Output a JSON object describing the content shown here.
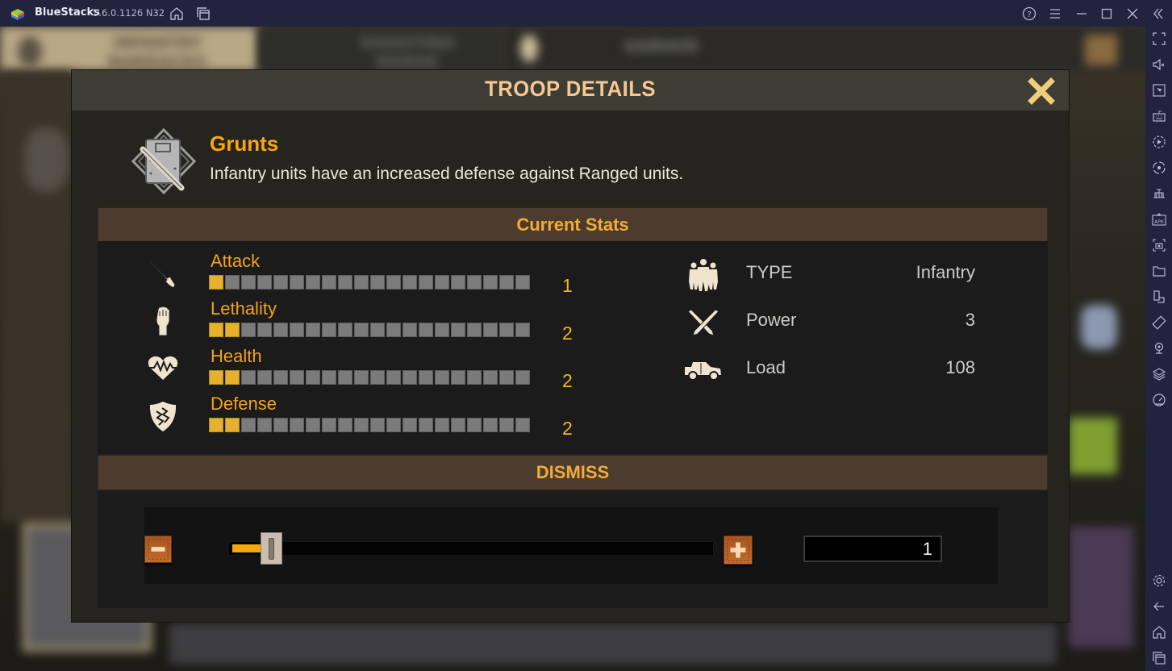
{
  "window": {
    "app_name": "BlueStacks",
    "version": "5.6.0.1126 N32",
    "titlebar_icons": [
      "home-icon",
      "multi-instance-icon",
      "help-icon",
      "menu-icon",
      "minimize-icon",
      "maximize-icon",
      "close-icon",
      "collapse-sidebar-icon"
    ]
  },
  "sidebar": {
    "icons": [
      "fullscreen-icon",
      "volume-mute-icon",
      "pointer-icon",
      "keyboard-icon",
      "macro-recorder-icon",
      "sync-icon",
      "bulk-build-icon",
      "install-apk-icon",
      "screenshot-icon",
      "folder-icon",
      "multi-instance-icon",
      "rotate-icon",
      "location-icon",
      "layers-icon",
      "performance-icon"
    ],
    "bottom_icons": [
      "settings-icon",
      "back-icon",
      "home-icon",
      "recent-apps-icon"
    ]
  },
  "background": {
    "tabs": [
      "INFANTRY BARRACKS",
      "SHOOTING RANGE",
      "GARAGE"
    ]
  },
  "modal": {
    "title": "TROOP DETAILS",
    "unit": {
      "name": "Grunts",
      "description": "Infantry units have an increased defense against Ranged units."
    },
    "current_stats_header": "Current Stats",
    "stats": [
      {
        "label": "Attack",
        "icon": "knife-icon",
        "value": "1",
        "filled": 1,
        "total": 20
      },
      {
        "label": "Lethality",
        "icon": "fist-icon",
        "value": "2",
        "filled": 2,
        "total": 20
      },
      {
        "label": "Health",
        "icon": "heartbeat-icon",
        "value": "2",
        "filled": 2,
        "total": 20
      },
      {
        "label": "Defense",
        "icon": "shield-icon",
        "value": "2",
        "filled": 2,
        "total": 20
      }
    ],
    "info": [
      {
        "label": "TYPE",
        "icon": "soldiers-icon",
        "value": "Infantry"
      },
      {
        "label": "Power",
        "icon": "crossed-knives-icon",
        "value": "3"
      },
      {
        "label": "Load",
        "icon": "truck-icon",
        "value": "108"
      }
    ],
    "dismiss_header": "DISMISS",
    "dismiss": {
      "quantity": "1",
      "slider_fraction": 0.08
    }
  },
  "colors": {
    "accent_orange": "#f6a612",
    "bar_filled": "#e4b22c",
    "bar_empty": "#7b7b7b",
    "section_bg": "#4d3c2e",
    "title_color": "#f6c792"
  }
}
